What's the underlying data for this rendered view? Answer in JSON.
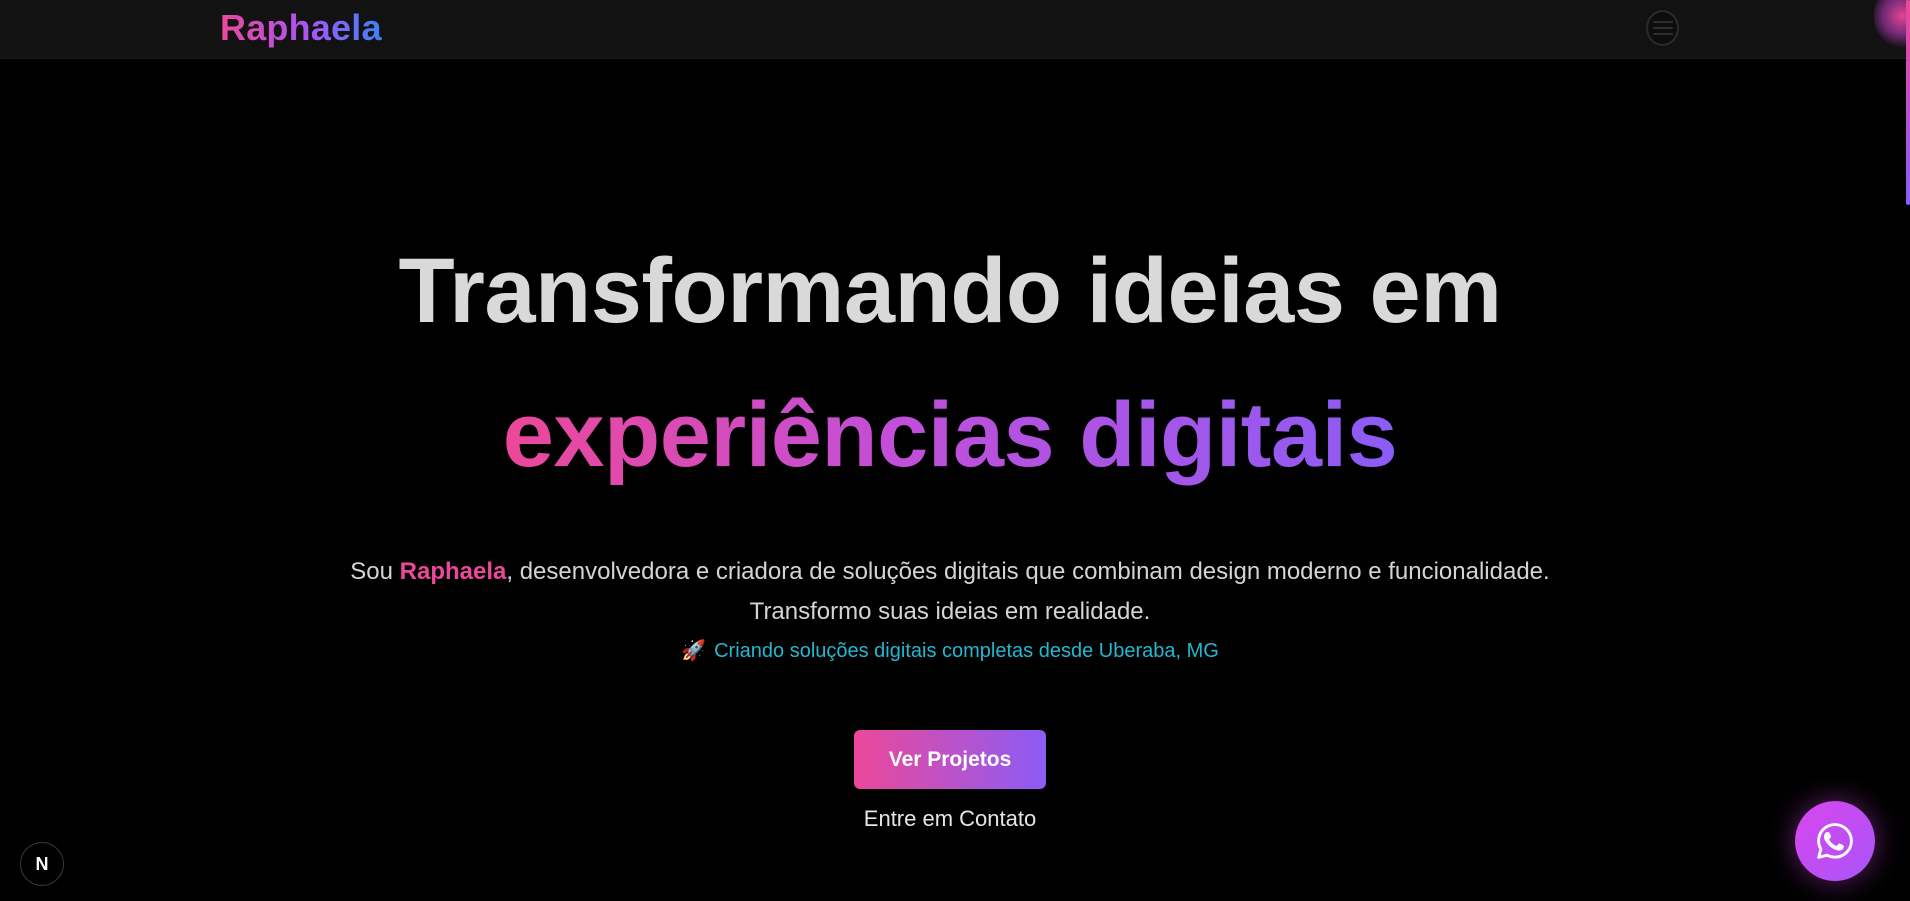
{
  "header": {
    "logo": "Raphaela",
    "menu_icon": "hamburger-menu-icon"
  },
  "hero": {
    "line1": "Transformando ideias em",
    "line2": "experiências digitais"
  },
  "intro": {
    "prefix": "Sou ",
    "name": "Raphaela",
    "suffix": ", desenvolvedora e criadora de soluções digitais que combinam design moderno e funcionalidade.",
    "line2": "Transformo suas ideias em realidade."
  },
  "location": {
    "icon": "rocket-icon",
    "rocket_glyph": "🚀",
    "text": "Criando soluções digitais completas desde Uberaba, MG"
  },
  "actions": {
    "primary_label": "Ver Projetos",
    "secondary_label": "Entre em Contato"
  },
  "badge": {
    "label": "N"
  },
  "whatsapp": {
    "icon": "whatsapp-icon"
  },
  "colors": {
    "background": "#000000",
    "header": "#121212",
    "accent_pink": "#ec4899",
    "accent_purple": "#8b5cf6",
    "accent_cyan": "#22b8cf",
    "heading_text": "#d9d9d9"
  }
}
